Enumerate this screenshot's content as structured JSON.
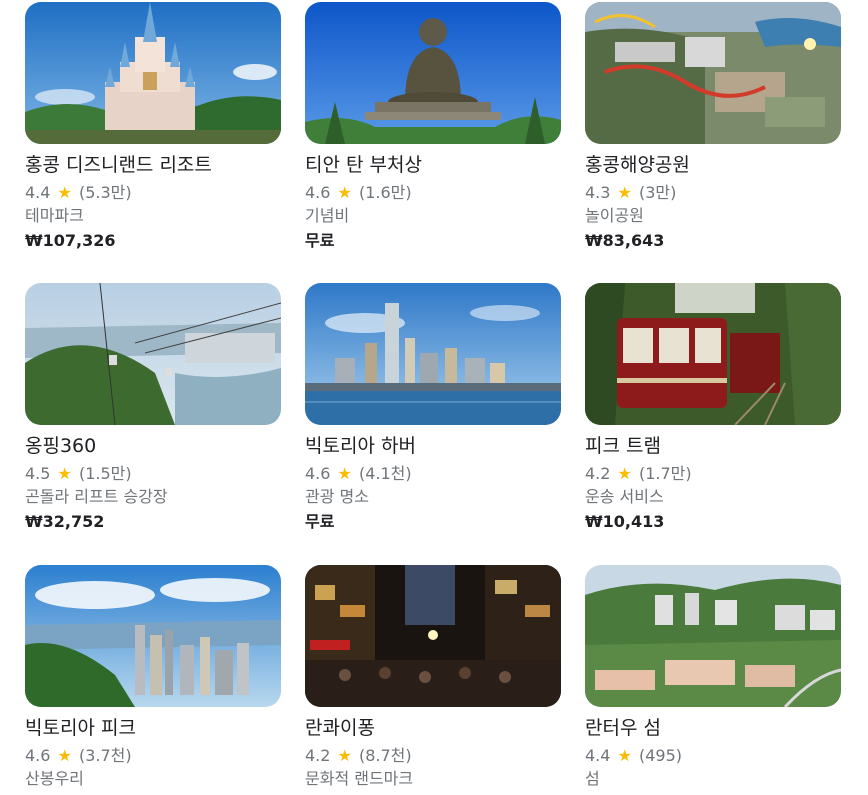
{
  "accent": {
    "star_color": "#fbbc04",
    "title_color": "#202124",
    "meta_color": "#70757a"
  },
  "places": [
    {
      "title": "홍콩 디즈니랜드 리조트",
      "rating": "4.4",
      "reviews": "(5.3만)",
      "category": "테마파크",
      "price": "₩107,326",
      "image": "castle-photo"
    },
    {
      "title": "티안 탄 부처상",
      "rating": "4.6",
      "reviews": "(1.6만)",
      "category": "기념비",
      "price": "무료",
      "image": "buddha-statue-photo"
    },
    {
      "title": "홍콩해양공원",
      "rating": "4.3",
      "reviews": "(3만)",
      "category": "놀이공원",
      "price": "₩83,643",
      "image": "theme-park-aerial-photo"
    },
    {
      "title": "옹핑360",
      "rating": "4.5",
      "reviews": "(1.5만)",
      "category": "곤돌라 리프트 승강장",
      "price": "₩32,752",
      "image": "cable-car-photo"
    },
    {
      "title": "빅토리아 하버",
      "rating": "4.6",
      "reviews": "(4.1천)",
      "category": "관광 명소",
      "price": "무료",
      "image": "harbour-skyline-photo"
    },
    {
      "title": "피크 트램",
      "rating": "4.2",
      "reviews": "(1.7만)",
      "category": "운송 서비스",
      "price": "₩10,413",
      "image": "red-tram-photo"
    },
    {
      "title": "빅토리아 피크",
      "rating": "4.6",
      "reviews": "(3.7천)",
      "category": "산봉우리",
      "price": "",
      "image": "peak-view-photo"
    },
    {
      "title": "란콰이퐁",
      "rating": "4.2",
      "reviews": "(8.7천)",
      "category": "문화적 랜드마크",
      "price": "",
      "image": "night-street-photo"
    },
    {
      "title": "란터우 섬",
      "rating": "4.4",
      "reviews": "(495)",
      "category": "섬",
      "price": "",
      "image": "island-town-photo"
    }
  ]
}
